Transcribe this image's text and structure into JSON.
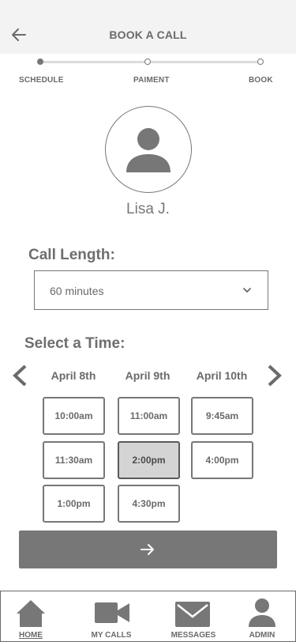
{
  "header": {
    "title": "BOOK A CALL",
    "back_icon": "arrow-left-icon"
  },
  "steps": [
    {
      "label": "SCHEDULE",
      "active": true
    },
    {
      "label": "PAIMENT",
      "active": false
    },
    {
      "label": "BOOK",
      "active": false
    }
  ],
  "profile": {
    "name": "Lisa J.",
    "avatar_icon": "user-silhouette-icon"
  },
  "call_length": {
    "title": "Call Length:",
    "selected": "60 minutes",
    "chevron_icon": "chevron-down-icon"
  },
  "time": {
    "title": "Select a Time:",
    "prev_icon": "chevron-left-icon",
    "next_icon": "chevron-right-icon",
    "dates": [
      "April 8th",
      "April 9th",
      "April 10th"
    ],
    "slots": [
      [
        "10:00am",
        "11:30am",
        "1:00pm"
      ],
      [
        "11:00am",
        "2:00pm",
        "4:30pm"
      ],
      [
        "9:45am",
        "4:00pm"
      ]
    ],
    "selected": "2:00pm"
  },
  "next_button": {
    "icon": "arrow-right-icon"
  },
  "tabbar": {
    "items": [
      {
        "label": "HOME",
        "icon": "home-icon",
        "active": true
      },
      {
        "label": "MY CALLS",
        "icon": "video-camera-icon",
        "active": false
      },
      {
        "label": "MESSAGES",
        "icon": "envelope-icon",
        "active": false
      },
      {
        "label": "ADMIN",
        "icon": "user-icon",
        "active": false
      }
    ]
  },
  "colors": {
    "primary": "#777777",
    "header_bg": "#f3f3f3",
    "selected_slot_bg": "#d4d4d4",
    "text": "#6a6a6a"
  }
}
